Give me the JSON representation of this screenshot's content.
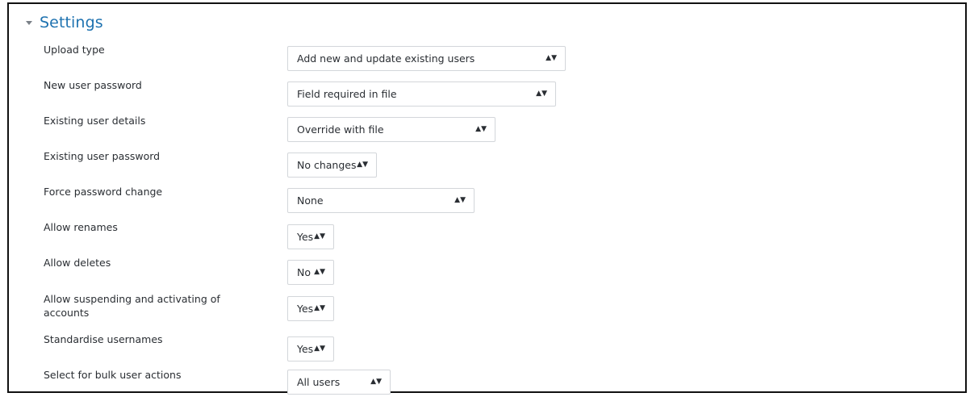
{
  "section": {
    "title": "Settings"
  },
  "settings": [
    {
      "label": "Upload type",
      "value": "Add new and update existing users"
    },
    {
      "label": "New user password",
      "value": "Field required in file"
    },
    {
      "label": "Existing user details",
      "value": "Override with file"
    },
    {
      "label": "Existing user password",
      "value": "No changes"
    },
    {
      "label": "Force password change",
      "value": "None"
    },
    {
      "label": "Allow renames",
      "value": "Yes"
    },
    {
      "label": "Allow deletes",
      "value": "No"
    },
    {
      "label": "Allow suspending and activating of accounts",
      "value": "Yes"
    },
    {
      "label": "Standardise usernames",
      "value": "Yes"
    },
    {
      "label": "Select for bulk user actions",
      "value": "All users"
    }
  ],
  "icons": {
    "collapse": "caret-down-icon",
    "select_arrows": "updown-arrows-icon"
  },
  "colors": {
    "section_title": "#1e72b0",
    "select_border": "#d3d6da"
  }
}
